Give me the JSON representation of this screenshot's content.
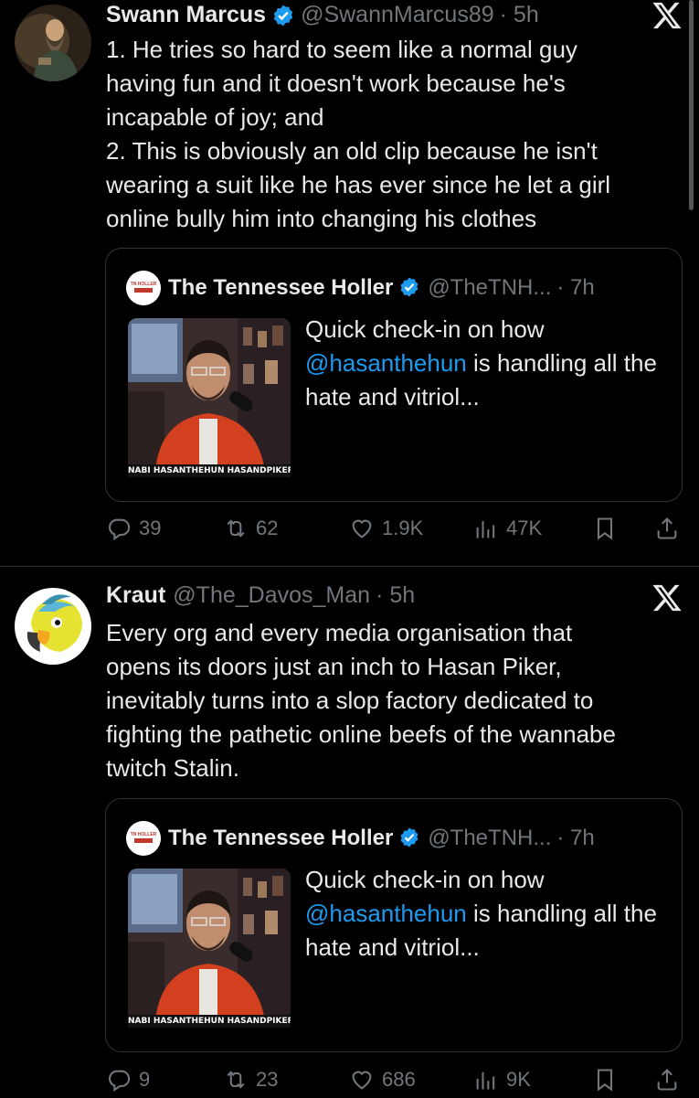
{
  "tweets": [
    {
      "name": "Swann Marcus",
      "handle": "@SwannMarcus89",
      "time": "· 5h",
      "verified": true,
      "text": "1. He tries so hard to seem like a normal guy\nhaving fun and it doesn't work because he's\nincapable of joy; and\n2. This is obviously an old clip because he isn't\nwearing a suit like he has ever since he let a girl\nonline bully him into changing his clothes",
      "quote": {
        "name": "The Tennessee Holler",
        "handle": "@TheTNH...",
        "time": "· 7h",
        "text_before": "Quick check-in on how ",
        "mention": "@hasanthehun",
        "text_after": " is handling all the hate and vitriol...",
        "thumb_caption": "NABI HASANTHEHUN HASANDPIKER"
      },
      "stats": {
        "replies": "39",
        "reposts": "62",
        "likes": "1.9K",
        "views": "47K"
      }
    },
    {
      "name": "Kraut",
      "handle": "@The_Davos_Man",
      "time": "· 5h",
      "verified": false,
      "text": "Every org and every media organisation that\nopens its doors just an inch to Hasan Piker,\ninevitably turns into a slop factory dedicated to\nfighting the pathetic online beefs of the wannabe\ntwitch Stalin.",
      "quote": {
        "name": "The Tennessee Holler",
        "handle": "@TheTNH...",
        "time": "· 7h",
        "text_before": "Quick check-in on how ",
        "mention": "@hasanthehun",
        "text_after": " is handling all the hate and vitriol...",
        "thumb_caption": "NABI HASANTHEHUN HASANDPIKER"
      },
      "stats": {
        "replies": "9",
        "reposts": "23",
        "likes": "686",
        "views": "9K"
      }
    }
  ],
  "colors": {
    "background": "#000000",
    "text": "#e7e9ea",
    "muted": "#71767b",
    "link": "#1d9bf0",
    "border": "#2f3336"
  },
  "icons": [
    "verified-badge-icon",
    "x-logo-icon",
    "reply-icon",
    "repost-icon",
    "like-icon",
    "views-icon",
    "bookmark-icon",
    "share-icon"
  ]
}
